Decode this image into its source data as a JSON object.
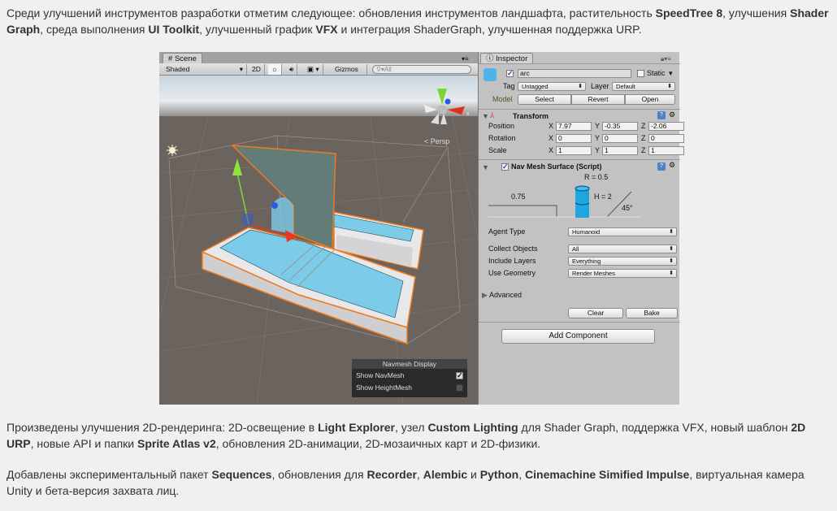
{
  "paragraphs": [
    [
      {
        "t": "Среди улучшений инструментов разработки отметим следующее: обновления инструментов ландшафта, растительность "
      },
      {
        "t": "SpeedTree 8",
        "b": true
      },
      {
        "t": ", улучшения "
      },
      {
        "t": "Shader Graph",
        "b": true
      },
      {
        "t": ", среда выполнения "
      },
      {
        "t": "UI Toolkit",
        "b": true
      },
      {
        "t": ", улучшенный график "
      },
      {
        "t": "VFX",
        "b": true
      },
      {
        "t": " и интеграция ShaderGraph, улучшенная поддержка URP."
      }
    ],
    [
      {
        "t": "Произведены улучшения 2D-рендеринга: 2D-освещение в "
      },
      {
        "t": "Light Explorer",
        "b": true
      },
      {
        "t": ", узел "
      },
      {
        "t": "Custom Lighting",
        "b": true
      },
      {
        "t": " для Shader Graph, поддержка VFX, новый шаблон "
      },
      {
        "t": "2D URP",
        "b": true
      },
      {
        "t": ", новые API и папки "
      },
      {
        "t": "Sprite Atlas v2",
        "b": true
      },
      {
        "t": ", обновления 2D-анимации, 2D-мозаичных карт и 2D-физики."
      }
    ],
    [
      {
        "t": "Добавлены экспериментальный пакет "
      },
      {
        "t": "Sequences",
        "b": true
      },
      {
        "t": ", обновления для "
      },
      {
        "t": "Recorder",
        "b": true
      },
      {
        "t": ", "
      },
      {
        "t": "Alembic",
        "b": true
      },
      {
        "t": " и "
      },
      {
        "t": "Python",
        "b": true
      },
      {
        "t": ", "
      },
      {
        "t": "Cinemachine Simified Impulse",
        "b": true
      },
      {
        "t": ", виртуальная камера Unity и бета-версия захвата лиц."
      }
    ]
  ],
  "scene": {
    "tab": "Scene",
    "shading": "Shaded",
    "mode_2d": "2D",
    "gizmos": "Gizmos",
    "search_placeholder": "All",
    "persp": "Persp",
    "axis_x": "x",
    "axis_y": "y",
    "navmesh_display": {
      "title": "Navmesh Display",
      "items": [
        {
          "label": "Show NavMesh",
          "checked": true
        },
        {
          "label": "Show HeightMesh",
          "checked": false
        }
      ]
    }
  },
  "inspector": {
    "tab": "Inspector",
    "name": "arc",
    "static_label": "Static",
    "tag_label": "Tag",
    "tag": "Untagged",
    "layer_label": "Layer",
    "layer": "Default",
    "model_label": "Model",
    "model_buttons": [
      "Select",
      "Revert",
      "Open"
    ],
    "transform": {
      "title": "Transform",
      "rows": [
        {
          "label": "Position",
          "x": "7.97",
          "y": "-0.35",
          "z": "-2.06"
        },
        {
          "label": "Rotation",
          "x": "0",
          "y": "0",
          "z": "0"
        },
        {
          "label": "Scale",
          "x": "1",
          "y": "1",
          "z": "1"
        }
      ],
      "axes": [
        "X",
        "Y",
        "Z"
      ]
    },
    "navmesh": {
      "title": "Nav Mesh Surface (Script)",
      "radius": "R = 0.5",
      "height": "H = 2",
      "step": "0.75",
      "slope": "45°",
      "fields": [
        {
          "label": "Agent Type",
          "value": "Humanoid"
        },
        {
          "label": "Collect Objects",
          "value": "All"
        },
        {
          "label": "Include Layers",
          "value": "Everything"
        },
        {
          "label": "Use Geometry",
          "value": "Render Meshes"
        }
      ],
      "advanced": "Advanced",
      "clear": "Clear",
      "bake": "Bake"
    },
    "add_component": "Add Component"
  }
}
